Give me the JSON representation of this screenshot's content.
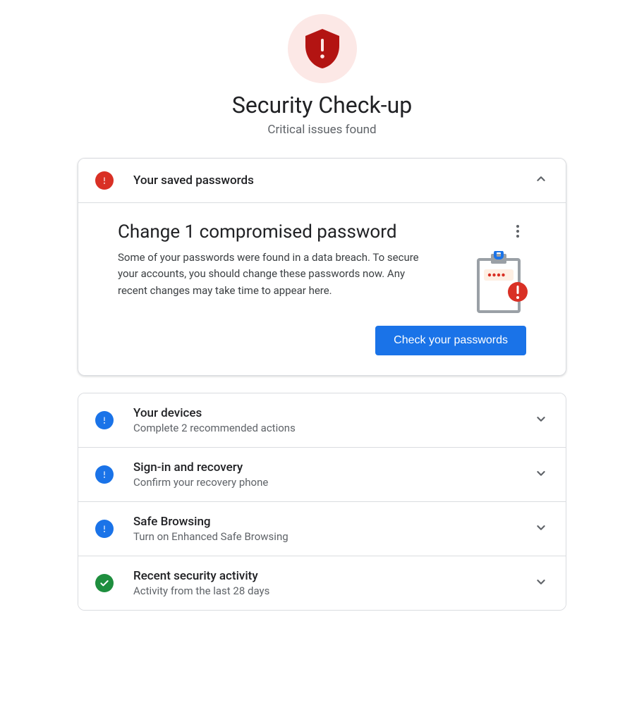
{
  "hero": {
    "title": "Security Check-up",
    "subtitle": "Critical issues found"
  },
  "passwords_card": {
    "header_title": "Your saved passwords",
    "panel_heading": "Change 1 compromised password",
    "panel_desc": "Some of your passwords were found in a data breach. To secure your accounts, you should change these passwords now. Any recent changes may take time to appear here.",
    "button_label": "Check your passwords"
  },
  "sections": [
    {
      "title": "Your devices",
      "subtitle": "Complete 2 recommended actions",
      "status": "blue"
    },
    {
      "title": "Sign-in and recovery",
      "subtitle": "Confirm your recovery phone",
      "status": "blue"
    },
    {
      "title": "Safe Browsing",
      "subtitle": "Turn on Enhanced Safe Browsing",
      "status": "blue"
    },
    {
      "title": "Recent security activity",
      "subtitle": "Activity from the last 28 days",
      "status": "green"
    }
  ]
}
